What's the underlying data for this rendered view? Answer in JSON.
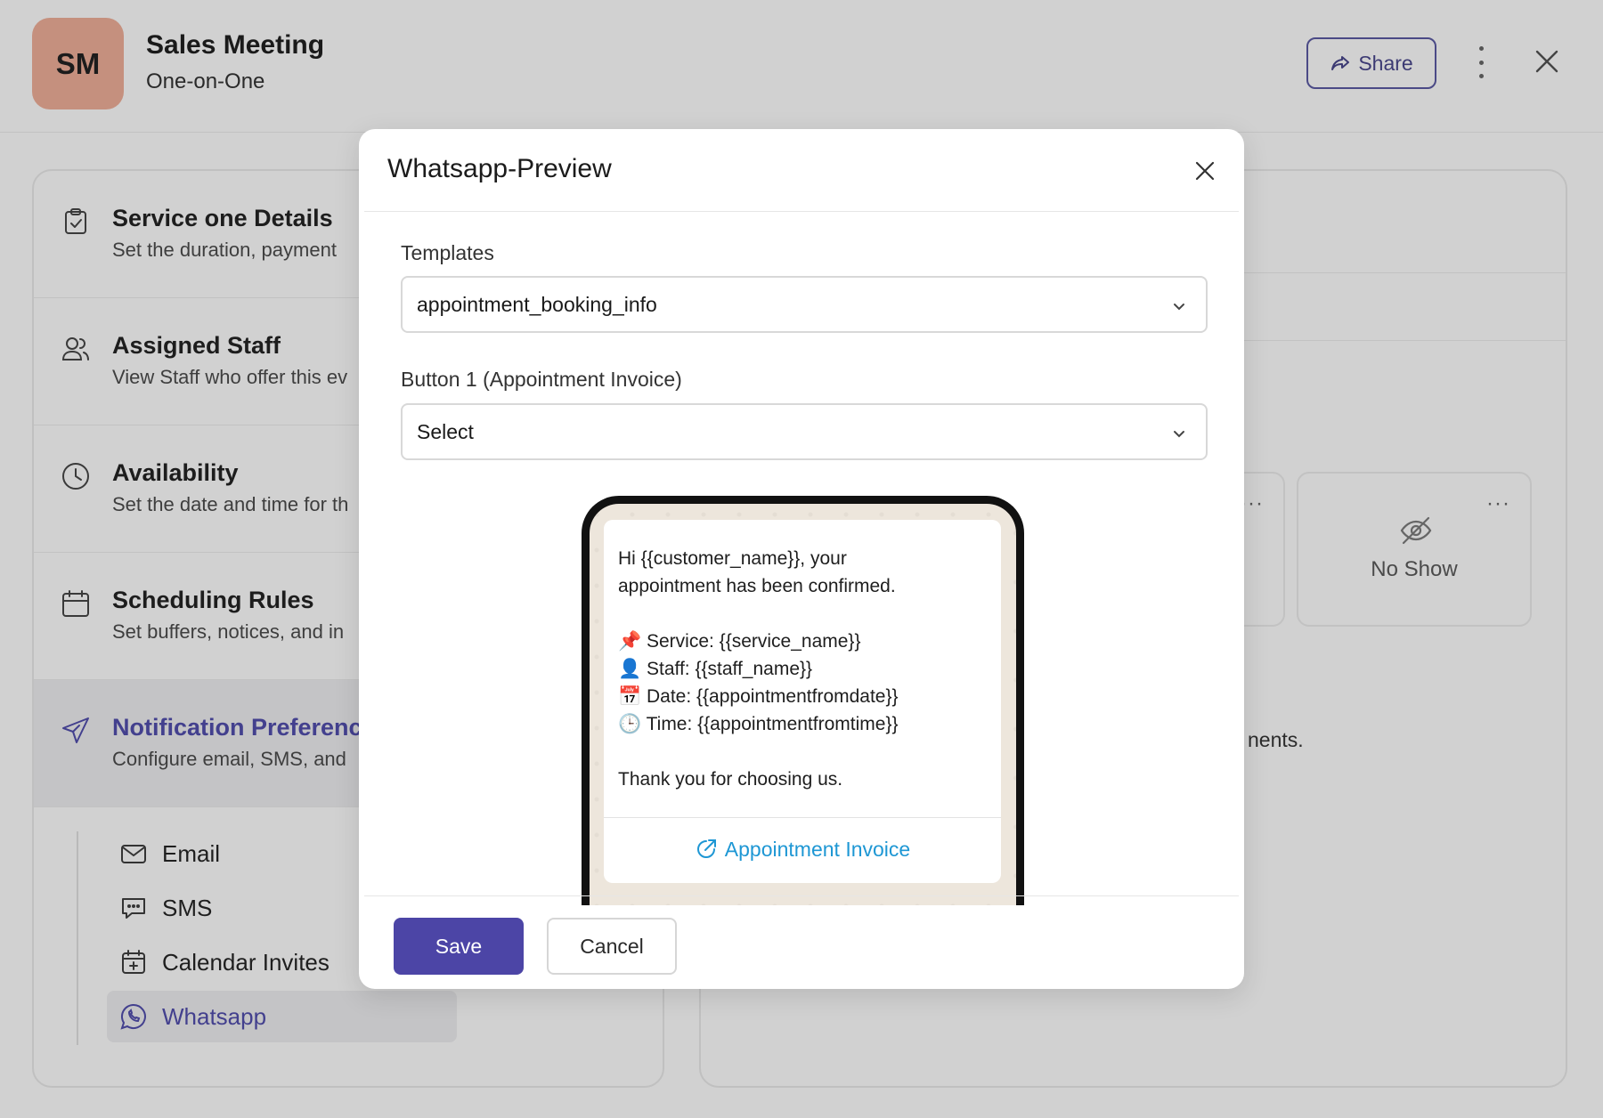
{
  "header": {
    "avatar_initials": "SM",
    "title": "Sales Meeting",
    "subtitle": "One-on-One",
    "share_label": "Share"
  },
  "sidebar": {
    "sections": [
      {
        "title": "Service one Details",
        "desc": "Set the duration, payment",
        "icon": "clipboard-check-icon"
      },
      {
        "title": "Assigned Staff",
        "desc": "View Staff who offer this ev",
        "icon": "users-icon"
      },
      {
        "title": "Availability",
        "desc": "Set the date and time for th",
        "icon": "clock-icon"
      },
      {
        "title": "Scheduling Rules",
        "desc": "Set buffers, notices, and in",
        "icon": "calendar-icon"
      },
      {
        "title": "Notification Preference",
        "desc": "Configure email, SMS, and",
        "icon": "send-icon"
      }
    ],
    "subitems": [
      {
        "label": "Email",
        "icon": "mail-icon"
      },
      {
        "label": "SMS",
        "icon": "chat-icon"
      },
      {
        "label": "Calendar Invites",
        "icon": "calendar-plus-icon"
      },
      {
        "label": "Whatsapp",
        "icon": "whatsapp-icon"
      }
    ]
  },
  "right_panel": {
    "card_label": "No Show",
    "partial_text": "nents."
  },
  "modal": {
    "title": "Whatsapp-Preview",
    "templates_label": "Templates",
    "templates_value": "appointment_booking_info",
    "button1_label": "Button 1 (Appointment Invoice)",
    "button1_value": "Select",
    "message": {
      "line1": "Hi {{customer_name}}, your",
      "line2": "appointment has been confirmed.",
      "service": "📌 Service: {{service_name}}",
      "staff": "👤 Staff: {{staff_name}}",
      "date": "📅 Date: {{appointmentfromdate}}",
      "time": "🕒 Time: {{appointmentfromtime}}",
      "thanks": "Thank you for choosing us."
    },
    "message_button": "Appointment Invoice",
    "save_label": "Save",
    "cancel_label": "Cancel"
  },
  "colors": {
    "accent": "#4c45a6",
    "link": "#1e97d4",
    "active_nav": "#43408e",
    "avatar_bg": "#c5907e"
  }
}
